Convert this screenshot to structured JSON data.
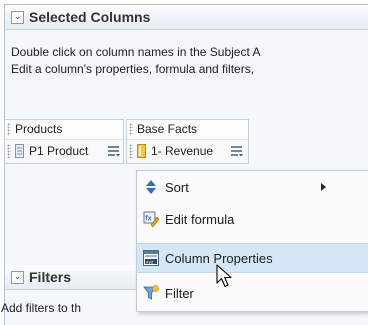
{
  "selected_columns": {
    "title": "Selected Columns",
    "collapse_glyph": "⌄",
    "description_line1": "Double click on column names in the Subject A",
    "description_line2": "Edit a column's properties, formula and filters,",
    "columns": [
      {
        "folder": "Products",
        "name": "P1 Product",
        "icon": "attribute-column-icon",
        "icon_color": "#8fa7c4"
      },
      {
        "folder": "Base Facts",
        "name": "1- Revenue",
        "icon": "measure-column-icon",
        "icon_color": "#f0b429"
      }
    ]
  },
  "context_menu": {
    "items": [
      {
        "label": "Sort",
        "icon": "sort-icon",
        "has_submenu": true
      },
      {
        "label": "Edit formula",
        "icon": "edit-formula-icon",
        "has_submenu": false
      },
      {
        "label": "Column Properties",
        "icon": "column-properties-icon",
        "has_submenu": false,
        "highlighted": true
      },
      {
        "label": "Filter",
        "icon": "filter-icon",
        "has_submenu": false
      }
    ]
  },
  "filters": {
    "title": "Filters",
    "collapse_glyph": "⌄",
    "description": "Add filters to th"
  },
  "colors": {
    "highlight": "#d5e6f6",
    "header_border": "#c9d3df"
  }
}
